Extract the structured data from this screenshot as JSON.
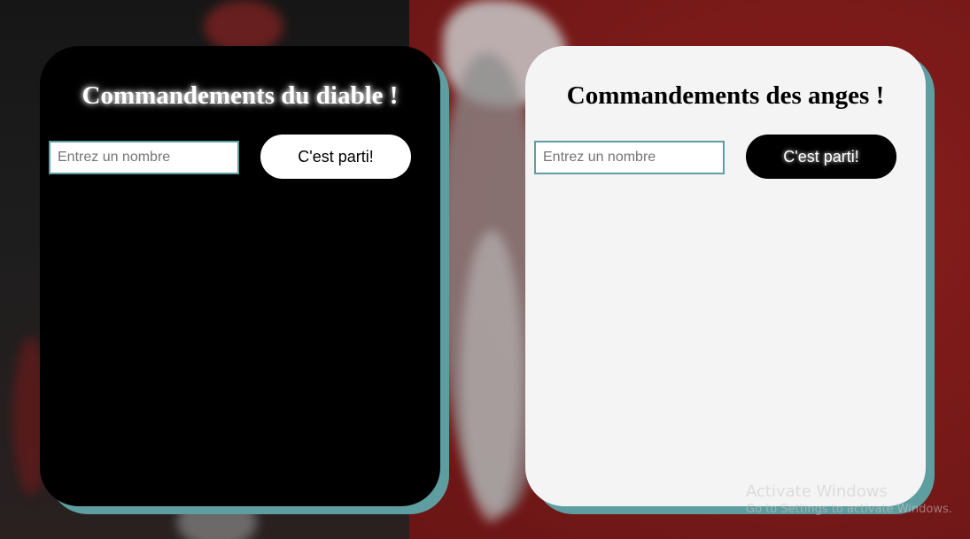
{
  "devil": {
    "title": "Commandements du diable !",
    "input_placeholder": "Entrez un nombre",
    "input_value": "",
    "button_label": "C'est parti!"
  },
  "angel": {
    "title": "Commandements des anges !",
    "input_placeholder": "Entrez un nombre",
    "input_value": "",
    "button_label": "C'est parti!"
  },
  "watermark": {
    "title": "Activate Windows",
    "subtitle": "Go to Settings to activate Windows."
  },
  "colors": {
    "accent": "#5f9ea0",
    "devil_card": "#000000",
    "angel_card": "#f4f4f4",
    "background_right": "#7a1a19"
  }
}
